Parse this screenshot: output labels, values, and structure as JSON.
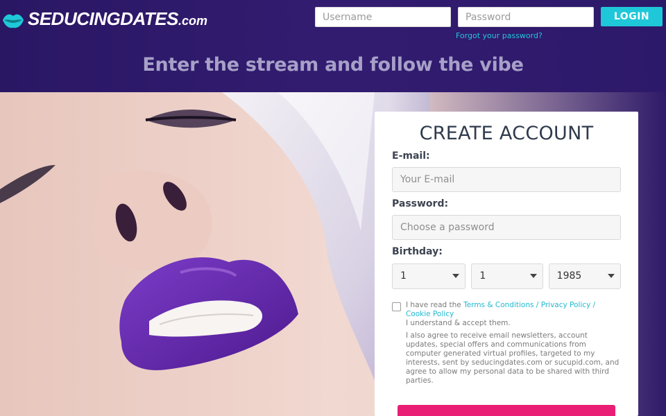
{
  "header": {
    "logo": {
      "brand": "SEDUCINGDATES",
      "suffix": ".com",
      "icon": "lips-logo-icon",
      "colors": {
        "lips": "#1fc8d8",
        "text": "#ffffff"
      }
    },
    "login": {
      "username_placeholder": "Username",
      "password_placeholder": "Password",
      "button_label": "LOGIN",
      "forgot_link": "Forgot your password?"
    },
    "tagline": "Enter the stream and follow the vibe"
  },
  "signup": {
    "title": "CREATE ACCOUNT",
    "email_label": "E-mail:",
    "email_placeholder": "Your E-mail",
    "password_label": "Password:",
    "password_placeholder": "Choose a password",
    "birthday_label": "Birthday:",
    "birthday": {
      "day": "1",
      "month": "1",
      "year": "1985"
    },
    "terms": {
      "prefix": "I have read the ",
      "link1": "Terms & Conditions",
      "sep1": " / ",
      "link2": "Privacy Policy",
      "sep2": " / ",
      "link3": "Cookie Policy",
      "accept": "I understand & accept them.",
      "consent": "I also agree to receive email newsletters, account updates, special offers and communications from computer generated virtual profiles, targeted to my interests, sent by seducingdates.com or sucupid.com, and agree to allow my personal data to be shared with third parties."
    }
  },
  "colors": {
    "background": "#2e1a68",
    "accent": "#1fc8d8",
    "submit": "#e81f74",
    "lipstick": "#6a2bb4"
  }
}
